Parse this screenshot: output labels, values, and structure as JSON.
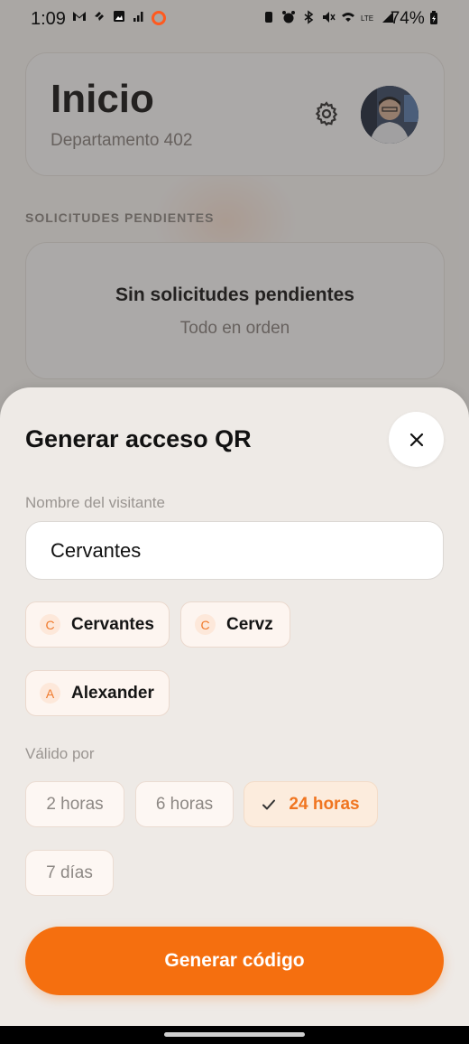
{
  "status_bar": {
    "time": "1:09",
    "battery": "74%",
    "left_icons": [
      "gmail-icon",
      "sync-icon",
      "image-icon",
      "signal-icon",
      "ring-icon"
    ],
    "right_icons": [
      "nfc-icon",
      "alarm-icon",
      "bluetooth-icon",
      "mute-icon",
      "wifi-icon",
      "lte-icon",
      "signal-bars-icon",
      "battery-icon"
    ]
  },
  "header": {
    "title": "Inicio",
    "subtitle": "Departamento 402"
  },
  "pending": {
    "section_label": "SOLICITUDES PENDIENTES",
    "empty_title": "Sin solicitudes pendientes",
    "empty_subtitle": "Todo en orden"
  },
  "sheet": {
    "title": "Generar acceso QR",
    "visitor_label": "Nombre del visitante",
    "visitor_value": "Cervantes",
    "suggestions": [
      {
        "initial": "C",
        "name": "Cervantes"
      },
      {
        "initial": "C",
        "name": "Cervz"
      },
      {
        "initial": "A",
        "name": "Alexander"
      }
    ],
    "valid_label": "Válido por",
    "durations": [
      {
        "label": "2 horas",
        "selected": false
      },
      {
        "label": "6 horas",
        "selected": false
      },
      {
        "label": "24 horas",
        "selected": true
      },
      {
        "label": "7 días",
        "selected": false
      }
    ],
    "generate_label": "Generar código"
  },
  "colors": {
    "accent": "#f56f0f",
    "selected_text": "#f07520"
  }
}
